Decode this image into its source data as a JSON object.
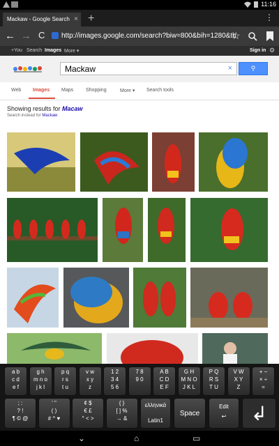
{
  "status": {
    "time": "11:16"
  },
  "tab": {
    "title": "Mackaw - Google Search",
    "close": "×",
    "newtab": "+"
  },
  "browser": {
    "url": "http://images.google.com/search?biw=800&bih=1280&tbm",
    "back": "←",
    "forward": "→",
    "reload": "C"
  },
  "gbar": {
    "you": "+You",
    "search": "Search",
    "images": "Images",
    "more": "More ▾",
    "signin": "Sign in"
  },
  "search": {
    "value": "Mackaw",
    "clear": "×",
    "button": "⚲"
  },
  "nav_tabs": {
    "web": "Web",
    "images": "Images",
    "maps": "Maps",
    "shopping": "Shopping",
    "more": "More ▾",
    "tools": "Search tools"
  },
  "results": {
    "prefix": "Showing results for ",
    "corrected": "Macaw",
    "instead_prefix": "Search instead for ",
    "instead": "Mackaw"
  },
  "keyboard": {
    "row1": [
      {
        "l1": "a b",
        "l2": "c d",
        "l3": "e f"
      },
      {
        "l1": "g h",
        "l2": "m n o",
        "l3": "j k l"
      },
      {
        "l1": "p q",
        "l2": "r s",
        "l3": "t u"
      },
      {
        "l1": "v w",
        "l2": "x y",
        "l3": "z"
      },
      {
        "l1": "1 2",
        "l2": "3 4",
        "l3": "5 6"
      },
      {
        "l1": "7 8",
        "l2": "9 0",
        "l3": ""
      },
      {
        "l1": "A B",
        "l2": "C D",
        "l3": "E F"
      },
      {
        "l1": "G H",
        "l2": "M N O",
        "l3": "J K L"
      },
      {
        "l1": "P Q",
        "l2": "R S",
        "l3": "T U"
      },
      {
        "l1": "V W",
        "l2": "X Y",
        "l3": "Z"
      },
      {
        "l1": "+ −",
        "l2": "× ÷",
        "l3": "="
      }
    ],
    "row2": [
      {
        "l1": "; :",
        "l2": "? !",
        "l3": "¶ © @"
      },
      {
        "l1": "' \"",
        "l2": "( )",
        "l3": "# ^ ♥"
      },
      {
        "l1": "¢ $",
        "l2": "€ £",
        "l3": "° < >"
      },
      {
        "l1": "{ }",
        "l2": "[ ] %",
        "l3": "→ &"
      }
    ],
    "lang_top": "ελληνικά",
    "lang_bottom": "Latin1",
    "space": "Space",
    "edit": "Edit",
    "edit_sub": "↩",
    "enter": "↲"
  },
  "sysnav": {
    "back": "⌄",
    "home": "⌂",
    "recent": "▭"
  }
}
